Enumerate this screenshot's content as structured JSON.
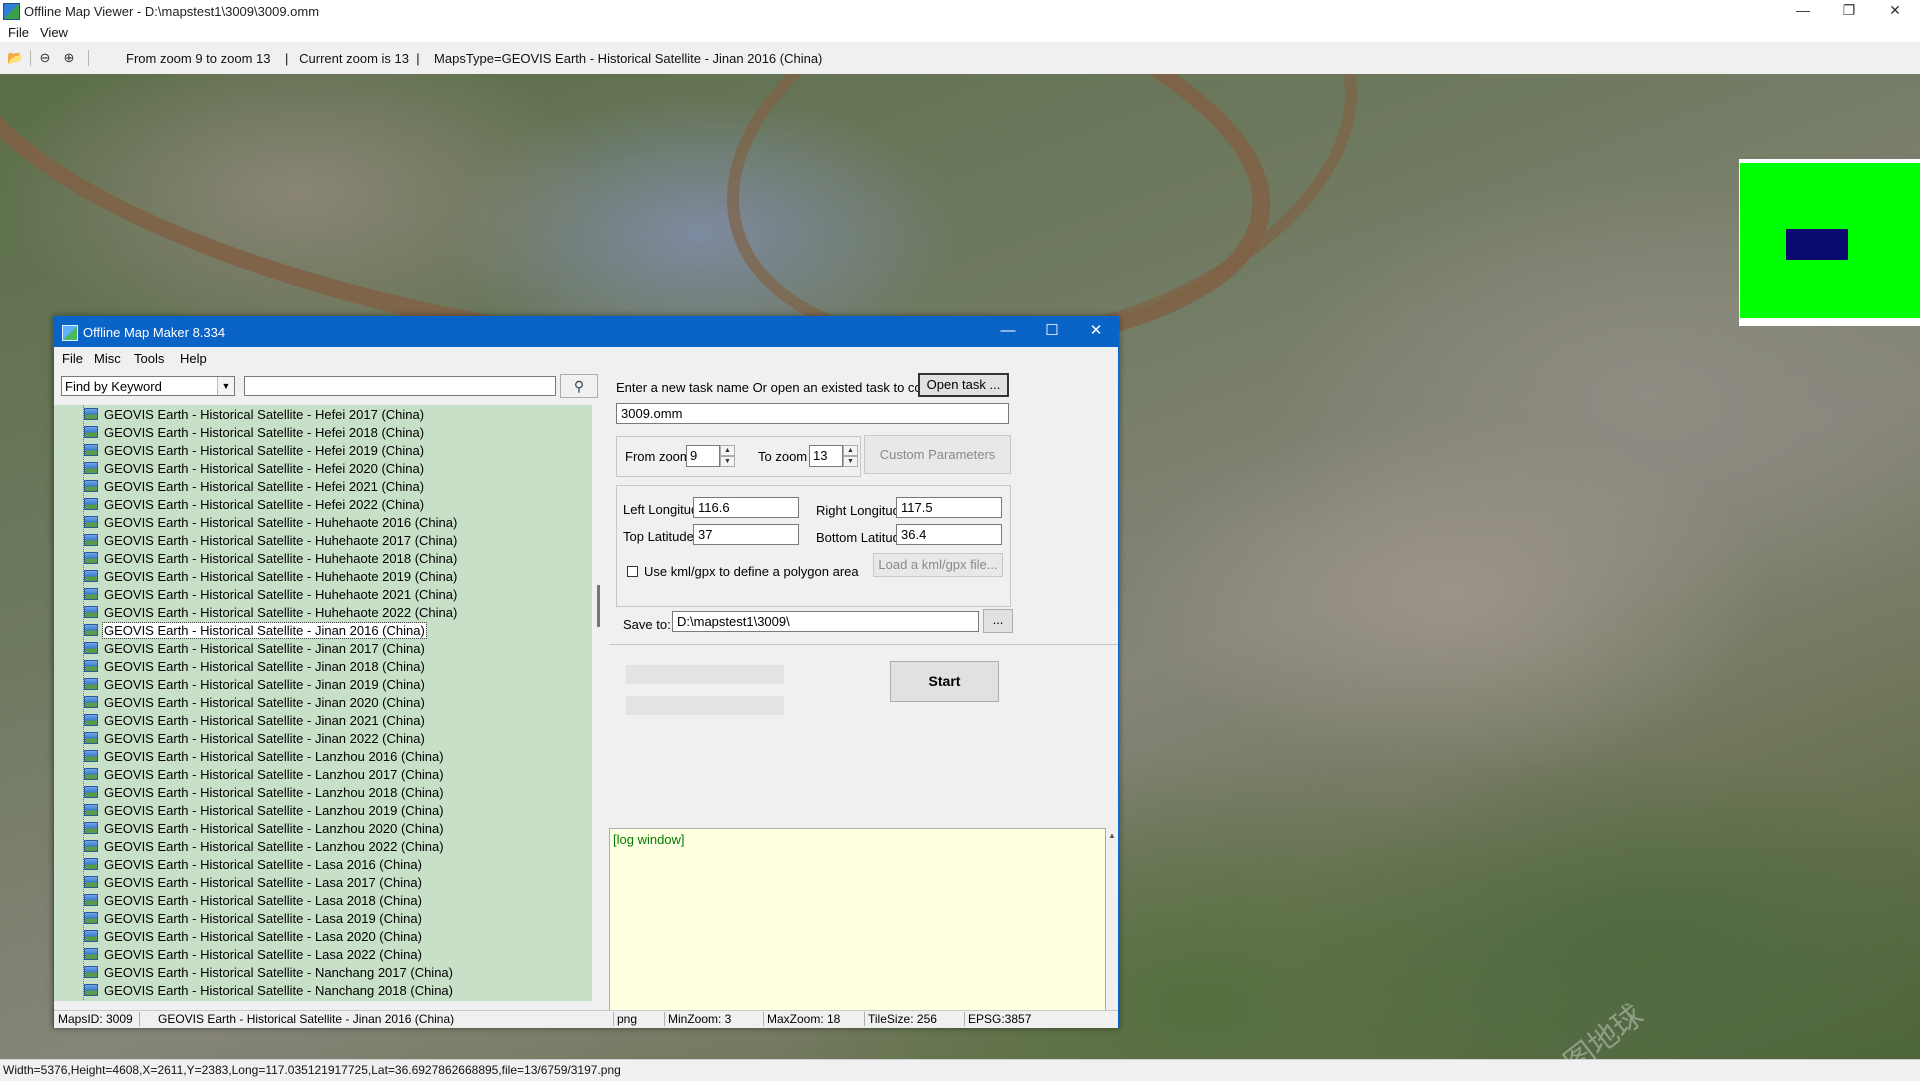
{
  "outer_window": {
    "title": "Offline Map Viewer - D:\\mapstest1\\3009\\3009.omm",
    "menu": [
      "File",
      "View"
    ],
    "toolbar_status": "From zoom 9 to zoom 13    |   Current zoom is 13  |    MapsType=GEOVIS Earth - Historical Satellite - Jinan 2016 (China)",
    "status": "Width=5376,Height=4608,X=2611,Y=2383,Long=117.035121917725,Lat=36.6927862668895,file=13/6759/3197.png"
  },
  "watermark": "星图地球",
  "dialog": {
    "title": "Offline Map Maker 8.334",
    "menu": [
      "File",
      "Misc",
      "Tools",
      "Help"
    ],
    "find": {
      "mode": "Find by Keyword",
      "keyword": ""
    },
    "map_types": [
      "GEOVIS Earth - Historical Satellite - Hefei 2017 (China)",
      "GEOVIS Earth - Historical Satellite - Hefei 2018 (China)",
      "GEOVIS Earth - Historical Satellite - Hefei 2019 (China)",
      "GEOVIS Earth - Historical Satellite - Hefei 2020 (China)",
      "GEOVIS Earth - Historical Satellite - Hefei 2021 (China)",
      "GEOVIS Earth - Historical Satellite - Hefei 2022 (China)",
      "GEOVIS Earth - Historical Satellite - Huhehaote 2016 (China)",
      "GEOVIS Earth - Historical Satellite - Huhehaote 2017 (China)",
      "GEOVIS Earth - Historical Satellite - Huhehaote 2018 (China)",
      "GEOVIS Earth - Historical Satellite - Huhehaote 2019 (China)",
      "GEOVIS Earth - Historical Satellite - Huhehaote 2021 (China)",
      "GEOVIS Earth - Historical Satellite - Huhehaote 2022 (China)",
      "GEOVIS Earth - Historical Satellite - Jinan 2016 (China)",
      "GEOVIS Earth - Historical Satellite - Jinan 2017 (China)",
      "GEOVIS Earth - Historical Satellite - Jinan 2018 (China)",
      "GEOVIS Earth - Historical Satellite - Jinan 2019 (China)",
      "GEOVIS Earth - Historical Satellite - Jinan 2020 (China)",
      "GEOVIS Earth - Historical Satellite - Jinan 2021 (China)",
      "GEOVIS Earth - Historical Satellite - Jinan 2022 (China)",
      "GEOVIS Earth - Historical Satellite - Lanzhou 2016 (China)",
      "GEOVIS Earth - Historical Satellite - Lanzhou 2017 (China)",
      "GEOVIS Earth - Historical Satellite - Lanzhou 2018 (China)",
      "GEOVIS Earth - Historical Satellite - Lanzhou 2019 (China)",
      "GEOVIS Earth - Historical Satellite - Lanzhou 2020 (China)",
      "GEOVIS Earth - Historical Satellite - Lanzhou 2022 (China)",
      "GEOVIS Earth - Historical Satellite - Lasa 2016 (China)",
      "GEOVIS Earth - Historical Satellite - Lasa 2017 (China)",
      "GEOVIS Earth - Historical Satellite - Lasa 2018 (China)",
      "GEOVIS Earth - Historical Satellite - Lasa 2019 (China)",
      "GEOVIS Earth - Historical Satellite - Lasa 2020 (China)",
      "GEOVIS Earth - Historical Satellite - Lasa 2022 (China)",
      "GEOVIS Earth - Historical Satellite - Nanchang 2017 (China)",
      "GEOVIS Earth - Historical Satellite - Nanchang 2018 (China)"
    ],
    "selected_map_type": "GEOVIS Earth - Historical Satellite - Jinan 2016 (China)",
    "task": {
      "prompt": "Enter a new task name Or open an existed task to continue:",
      "open_label": "Open task ...",
      "name": "3009.omm"
    },
    "zoom": {
      "from_label": "From zoom",
      "from": "9",
      "to_label": "To zoom",
      "to": "13",
      "custom_label": "Custom Parameters"
    },
    "bounds": {
      "left_label": "Left Longitude",
      "left": "116.6",
      "right_label": "Right Longitude",
      "right": "117.5",
      "top_label": "Top Latitude",
      "top": "37",
      "bottom_label": "Bottom Latitude",
      "bottom": "36.4",
      "kml_label": "Use kml/gpx to define a polygon area",
      "kml_checked": false,
      "load_kml_label": "Load a kml/gpx file..."
    },
    "save": {
      "label": "Save to:",
      "path": "D:\\mapstest1\\3009\\",
      "browse_label": "..."
    },
    "start_label": "Start",
    "progress": [
      0,
      0
    ],
    "log": "[log window]",
    "status": {
      "maps_id": "MapsID: 3009",
      "map_name": "GEOVIS Earth - Historical Satellite - Jinan 2016 (China)",
      "format": "png",
      "min_zoom": "MinZoom: 3",
      "max_zoom": "MaxZoom: 18",
      "tile_size": "TileSize: 256",
      "epsg": "EPSG:3857"
    }
  },
  "colors": {
    "dialog_title": "#0a64c8",
    "list_background": "#c8e0c8",
    "log_background": "#ffffe1",
    "minimap_frame": "#00ff00",
    "minimap_viewport": "#0a0a6e"
  },
  "icons": {
    "open": "folder-open-icon",
    "zoom_out": "zoom-out-icon",
    "zoom_in": "zoom-in-icon",
    "search": "search-icon"
  }
}
